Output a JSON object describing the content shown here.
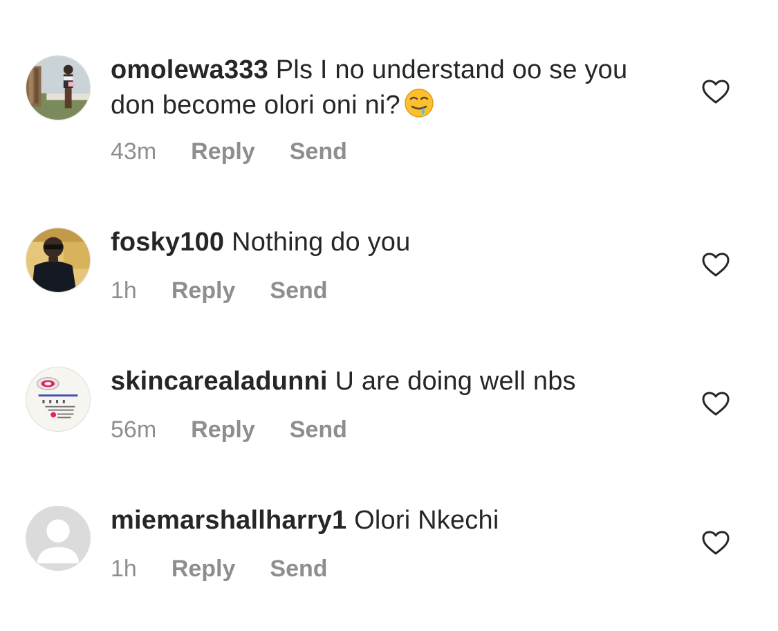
{
  "comments": [
    {
      "username": "omolewa333",
      "text": "Pls I no understand oo se you don become olori oni ni?",
      "emoji": "drooling-face-emoji",
      "time": "43m",
      "reply_label": "Reply",
      "send_label": "Send",
      "avatar": "photo-woman-outdoors"
    },
    {
      "username": "fosky100",
      "text": "Nothing do you",
      "time": "1h",
      "reply_label": "Reply",
      "send_label": "Send",
      "avatar": "photo-man-sunglasses"
    },
    {
      "username": "skincarealadunni",
      "text": "U are doing well nbs",
      "time": "56m",
      "reply_label": "Reply",
      "send_label": "Send",
      "avatar": "skincare-logo",
      "avatar_logo_text": "Skincarealadunni"
    },
    {
      "username": "miemarshallharry1",
      "text": "Olori Nkechi",
      "time": "1h",
      "reply_label": "Reply",
      "send_label": "Send",
      "avatar": "default-user-silhouette"
    }
  ],
  "colors": {
    "text": "#262626",
    "meta": "#8e8e8e",
    "background": "#ffffff"
  },
  "icons": {
    "like": "heart-outline-icon"
  }
}
